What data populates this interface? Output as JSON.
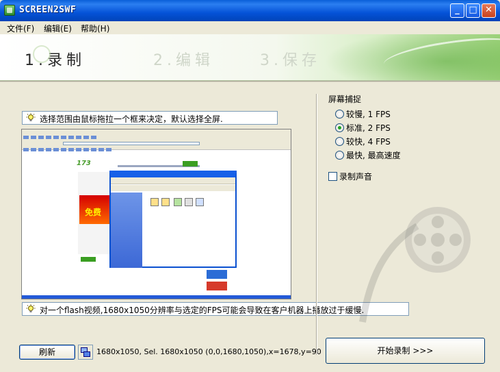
{
  "window": {
    "title": "SCREEN2SWF",
    "icon": "app-icon",
    "controls": {
      "minimize": "_",
      "maximize": "□",
      "close": "✕"
    }
  },
  "menu": {
    "file": "文件(F)",
    "edit": "编辑(E)",
    "help": "帮助(H)"
  },
  "steps": {
    "record": "1.录制",
    "edit": "2.编辑",
    "save": "3.保存"
  },
  "tips": {
    "selection": "选择范围由鼠标拖拉一个框来决定，默认选择全屏.",
    "warning": "对一个flash视频,1680x1050分辨率与选定的FPS可能会导致在客户机器上播放过于缓慢."
  },
  "preview": {
    "logo_text": "173",
    "ad_text": "免费"
  },
  "bottom": {
    "refresh_label": "刷新",
    "status": "1680x1050, Sel. 1680x1050 (0,0,1680,1050),x=1678,y=90"
  },
  "capture": {
    "title": "屏幕捕捉",
    "options": [
      {
        "label": "较慢, 1 FPS",
        "checked": false
      },
      {
        "label": "标准, 2 FPS",
        "checked": true
      },
      {
        "label": "较快, 4 FPS",
        "checked": false
      },
      {
        "label": "最快, 最高速度",
        "checked": false
      }
    ],
    "record_audio_label": "录制声音",
    "record_audio_checked": false
  },
  "start_button_label": "开始录制 >>>",
  "colors": {
    "titlebar": "#0553d8",
    "banner_accent": "#9ed37c",
    "radio_checked": "#21a121"
  }
}
